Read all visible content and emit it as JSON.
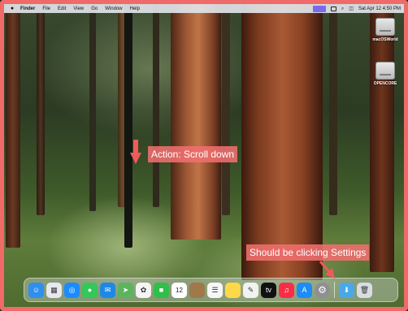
{
  "menubar": {
    "apple_icon": "apple-icon",
    "app_name": "Finder",
    "items": [
      "File",
      "Edit",
      "View",
      "Go",
      "Window",
      "Help"
    ],
    "datetime": "Sat Apr 12  4:50 PM"
  },
  "desktop": {
    "icons": [
      {
        "label": "macOSWorld",
        "icon": "drive-icon"
      },
      {
        "label": "OPENCORE",
        "icon": "drive-icon"
      }
    ]
  },
  "annotations": {
    "action": "Action: Scroll down",
    "feedback": "Should be clicking Settings",
    "color": "#f06a6a"
  },
  "dock": {
    "apps": [
      {
        "name": "finder",
        "glyph": "☺",
        "color": "#2f8ff0"
      },
      {
        "name": "launchpad",
        "glyph": "▦",
        "color": "#e8e8f0"
      },
      {
        "name": "safari",
        "glyph": "◎",
        "color": "#1a8cff"
      },
      {
        "name": "messages",
        "glyph": "●",
        "color": "#34c759"
      },
      {
        "name": "mail",
        "glyph": "✉",
        "color": "#1e88e5"
      },
      {
        "name": "maps",
        "glyph": "➤",
        "color": "#5ab55e"
      },
      {
        "name": "photos",
        "glyph": "✿",
        "color": "#f4f4f4"
      },
      {
        "name": "facetime",
        "glyph": "■",
        "color": "#2fbf4a"
      },
      {
        "name": "calendar",
        "glyph": "12",
        "color": "#ffffff"
      },
      {
        "name": "notes-brown",
        "glyph": "",
        "color": "#a0784a"
      },
      {
        "name": "reminders",
        "glyph": "☰",
        "color": "#f7f7f7"
      },
      {
        "name": "notes",
        "glyph": "",
        "color": "#ffd84a"
      },
      {
        "name": "freeform",
        "glyph": "✎",
        "color": "#f2f2f2"
      },
      {
        "name": "tv",
        "glyph": "tv",
        "color": "#111111"
      },
      {
        "name": "music",
        "glyph": "♫",
        "color": "#fa2d48"
      },
      {
        "name": "app-store",
        "glyph": "A",
        "color": "#1d8cf5"
      },
      {
        "name": "system-settings",
        "glyph": "⚙",
        "color": "#8e8e93"
      }
    ],
    "right_items": [
      {
        "name": "downloads-folder",
        "glyph": "⬇",
        "color": "#4aa8e8"
      },
      {
        "name": "trash",
        "glyph": "🗑",
        "color": "#d8dde2"
      }
    ]
  }
}
